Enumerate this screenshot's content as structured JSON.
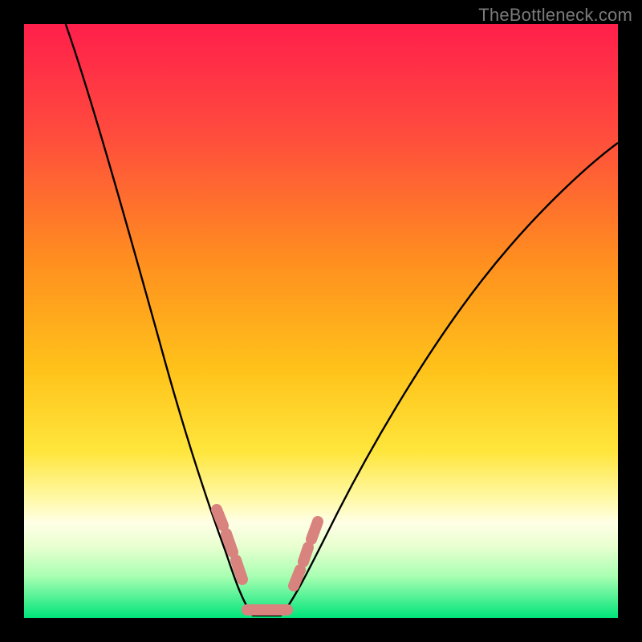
{
  "watermark": {
    "text": "TheBottleneck.com"
  },
  "chart_data": {
    "type": "line",
    "title": "",
    "xlabel": "",
    "ylabel": "",
    "xlim": [
      0,
      100
    ],
    "ylim": [
      0,
      100
    ],
    "grid": false,
    "legend": false,
    "background_gradient": {
      "stops": [
        {
          "offset": 0.0,
          "color": "#ff1f4b"
        },
        {
          "offset": 0.5,
          "color": "#ffb400"
        },
        {
          "offset": 0.75,
          "color": "#ffe63c"
        },
        {
          "offset": 0.82,
          "color": "#ffffc0"
        },
        {
          "offset": 0.9,
          "color": "#bfffb0"
        },
        {
          "offset": 1.0,
          "color": "#00e47a"
        }
      ]
    },
    "series": [
      {
        "name": "bottleneck-curve",
        "color": "#000000",
        "x": [
          7,
          10,
          14,
          18,
          22,
          26,
          30,
          32,
          34,
          36,
          38,
          40,
          43,
          46,
          50,
          55,
          60,
          65,
          70,
          75,
          80,
          85,
          90,
          95,
          100
        ],
        "y": [
          100,
          90,
          78,
          66,
          55,
          44,
          33,
          25,
          18,
          10,
          4,
          0,
          0,
          4,
          10,
          18,
          26,
          34,
          42,
          49,
          56,
          62,
          67,
          71,
          74
        ]
      }
    ],
    "annotations": {
      "valley_markers": {
        "color": "#d9837e",
        "left": {
          "x": [
            31.5,
            33.5,
            35.5
          ],
          "y": [
            22,
            15,
            8
          ]
        },
        "right": {
          "x": [
            45.0,
            46.5,
            48.5
          ],
          "y": [
            8,
            14,
            18
          ]
        },
        "floor": {
          "x_range": [
            36.5,
            43.5
          ],
          "y": 0
        }
      }
    }
  }
}
